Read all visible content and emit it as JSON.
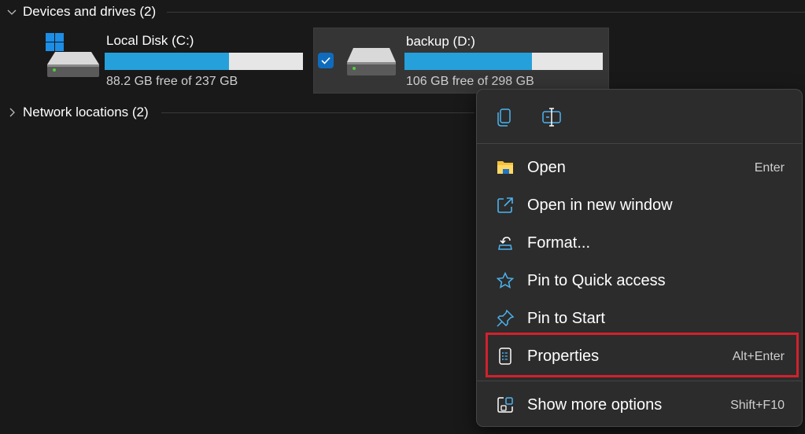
{
  "sections": {
    "devices": {
      "label": "Devices and drives (2)"
    },
    "network": {
      "label": "Network locations (2)"
    }
  },
  "drives": [
    {
      "name": "Local Disk (C:)",
      "free_text": "88.2 GB free of 237 GB",
      "used_fraction": 0.627,
      "selected": false,
      "icon": "windows-drive-icon"
    },
    {
      "name": "backup (D:)",
      "free_text": "106 GB free of 298 GB",
      "used_fraction": 0.644,
      "selected": true,
      "icon": "drive-icon"
    }
  ],
  "context_menu": {
    "top_actions": [
      {
        "name": "copy-icon"
      },
      {
        "name": "rename-icon"
      }
    ],
    "items": [
      {
        "label": "Open",
        "shortcut": "Enter",
        "icon": "folder-icon"
      },
      {
        "label": "Open in new window",
        "shortcut": "",
        "icon": "open-new-window-icon"
      },
      {
        "label": "Format...",
        "shortcut": "",
        "icon": "format-icon"
      },
      {
        "label": "Pin to Quick access",
        "shortcut": "",
        "icon": "star-icon"
      },
      {
        "label": "Pin to Start",
        "shortcut": "",
        "icon": "pin-icon"
      },
      {
        "label": "Properties",
        "shortcut": "Alt+Enter",
        "icon": "properties-icon"
      }
    ],
    "more": {
      "label": "Show more options",
      "shortcut": "Shift+F10",
      "icon": "more-options-icon"
    }
  },
  "colors": {
    "background": "#191919",
    "accent": "#26a0da",
    "checkbox": "#0f6cbd",
    "highlight": "#d2212c"
  }
}
